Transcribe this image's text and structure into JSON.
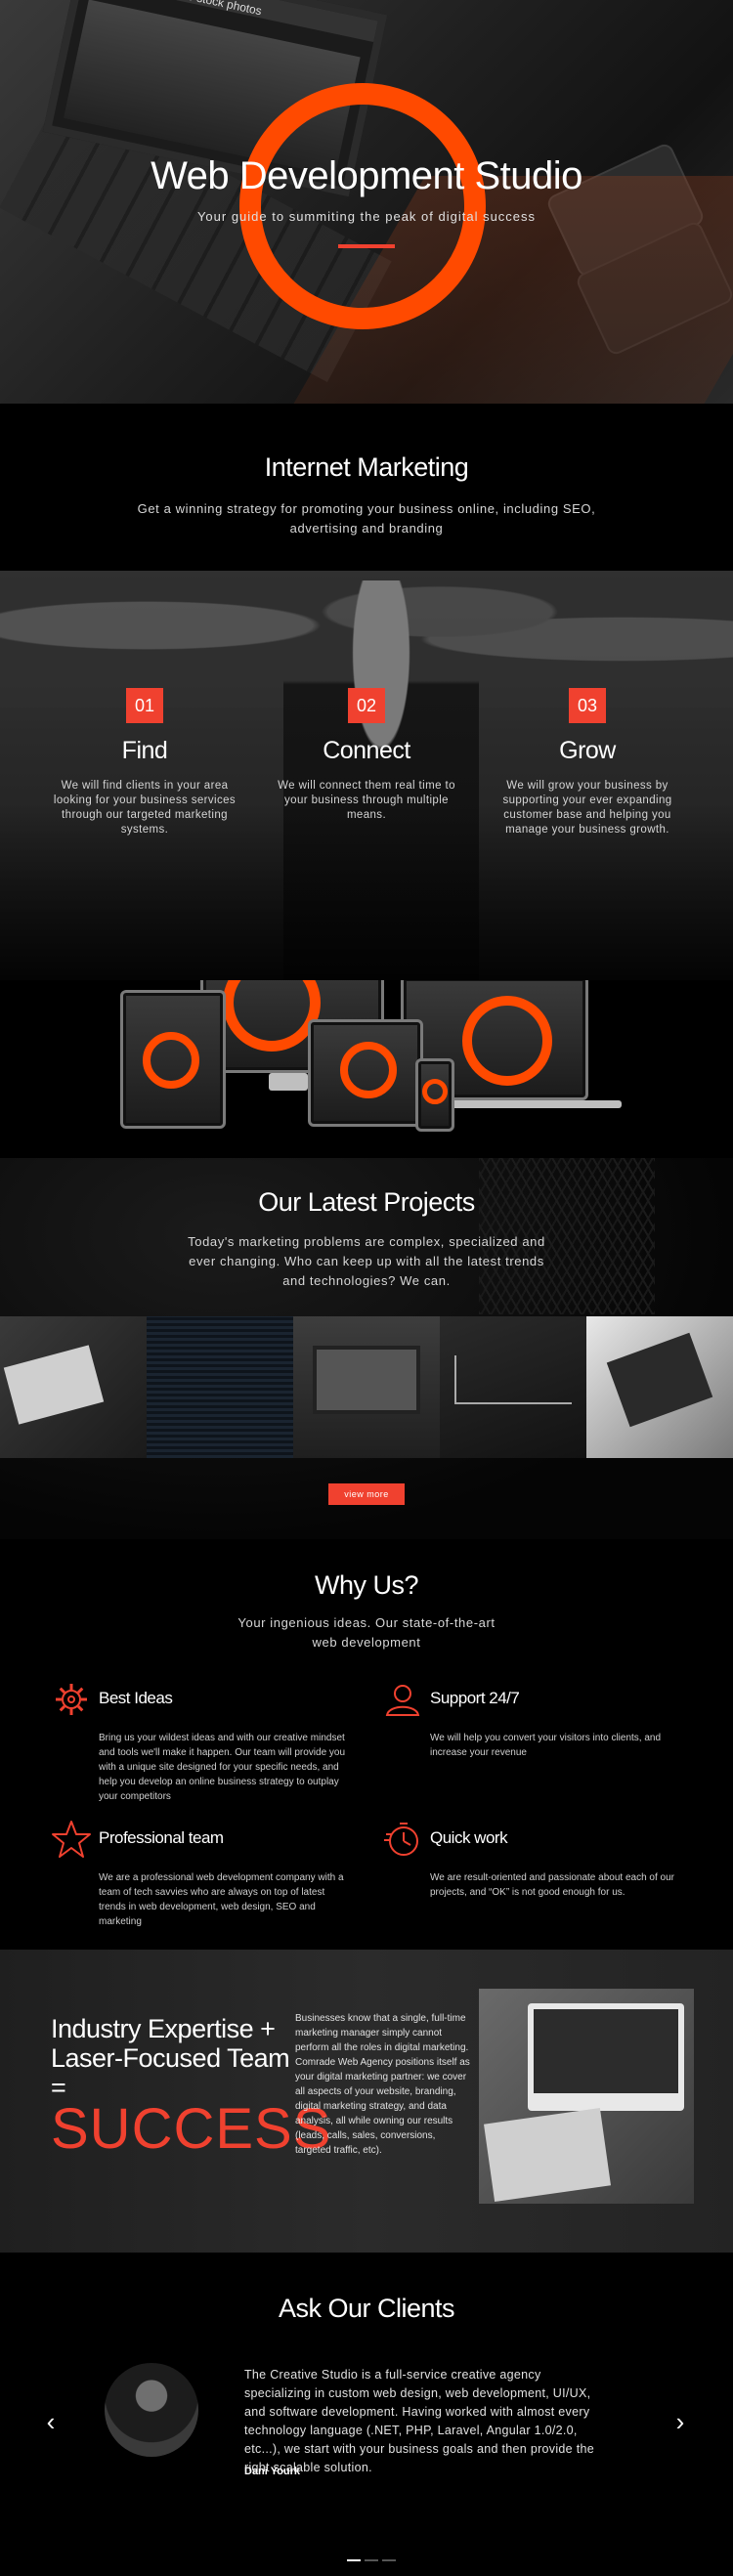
{
  "hero": {
    "laptop_screen_text": "Free stock photos",
    "title": "Web Development Studio",
    "subtitle": "Your guide to summiting the peak of digital success"
  },
  "marketing": {
    "title": "Internet Marketing",
    "text": "Get a winning strategy for promoting your business online, including SEO, advertising and branding"
  },
  "steps": [
    {
      "num": "01",
      "title": "Find",
      "text": "We will find clients in your area looking for your business services through our targeted marketing systems."
    },
    {
      "num": "02",
      "title": "Connect",
      "text": "We will connect them real time to your business through multiple means."
    },
    {
      "num": "03",
      "title": "Grow",
      "text": "We will grow your business by supporting your ever expanding customer base and helping you manage your business growth."
    }
  ],
  "projects": {
    "title": "Our Latest Projects",
    "text": "Today's marketing problems are complex, specialized and ever changing. Who can keep up with all the latest trends and technologies? We can.",
    "button": "view more"
  },
  "whyus": {
    "title": "Why Us?",
    "subtitle": "Your ingenious ideas. Our state-of-the-art web development",
    "features": [
      {
        "icon": "gear-icon",
        "title": "Best Ideas",
        "text": "Bring us your wildest ideas and with our creative mindset and tools we'll make it happen. Our team will provide you with a unique site designed for your specific needs, and help you develop an online business strategy to outplay your competitors"
      },
      {
        "icon": "user-icon",
        "title": "Support 24/7",
        "text": "We will help you convert your visitors into clients, and increase your revenue"
      },
      {
        "icon": "star-icon",
        "title": "Professional team",
        "text": "We are a professional web development company with a team of tech savvies who are always on top of latest trends in web development, web design, SEO and marketing"
      },
      {
        "icon": "stopwatch-icon",
        "title": "Quick work",
        "text": "We are result-oriented and passionate about each of our projects, and “OK” is not good enough for us."
      }
    ]
  },
  "success": {
    "heading": "Industry Expertise + Laser-Focused Team =",
    "big": "SUCCESS",
    "text": "Businesses know that a single, full-time marketing manager simply cannot perform all the roles in digital marketing. Comrade Web Agency positions itself as your digital marketing partner: we cover all aspects of your website, branding, digital marketing strategy, and data analysis, all while owning our results (leads, calls, sales, conversions, targeted traffic, etc)."
  },
  "clients": {
    "title": "Ask Our Clients",
    "quote": "The Creative Studio is a full-service creative agency specializing in custom web design, web development, UI/UX, and software development. Having worked with almost every technology language (.NET, PHP, Laravel, Angular 1.0/2.0, etc...), we start with your business goals and then provide the right scalable solution.",
    "author": "Dani Yourk",
    "prev": "‹",
    "next": "›"
  },
  "colors": {
    "accent": "#f0412f",
    "ring": "#ff4a00",
    "background": "#000000"
  }
}
